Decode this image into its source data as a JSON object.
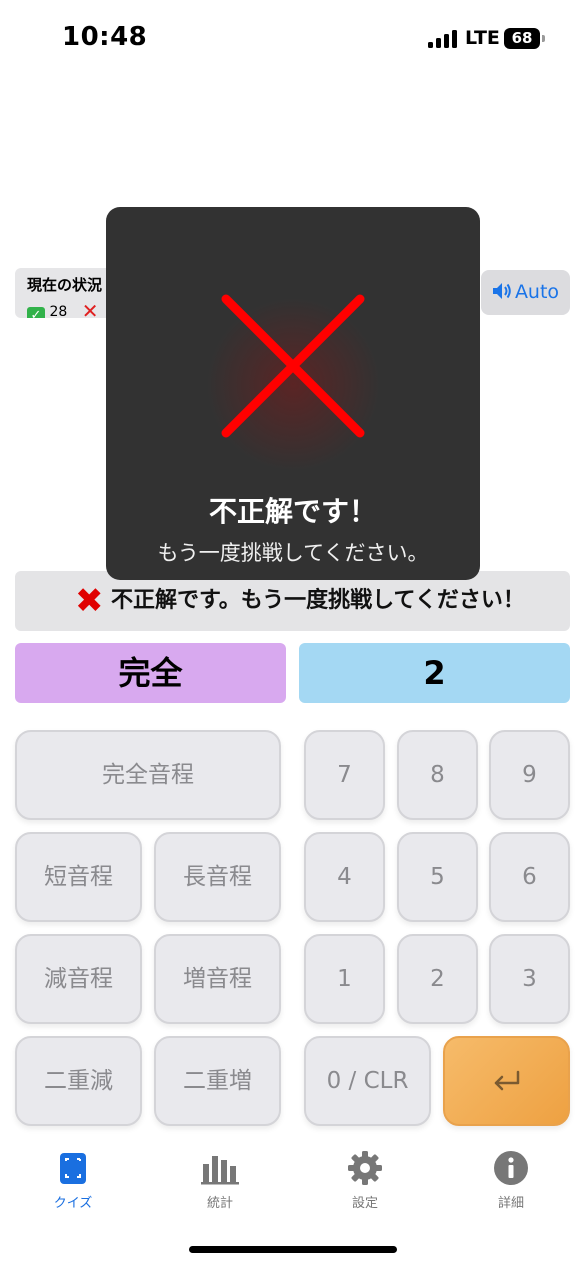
{
  "status_bar": {
    "time": "10:48",
    "network": "LTE",
    "battery": "68"
  },
  "status_box": {
    "title": "現在の状況",
    "correct_count": "28",
    "correct_icon": "check-icon",
    "wrong_icon": "cross-icon"
  },
  "audio": {
    "label": "Auto",
    "icon": "speaker-icon"
  },
  "feedback": {
    "icon": "cross-icon",
    "message": "不正解です。もう一度挑戦してください！"
  },
  "answer": {
    "quality": "完全",
    "number": "2"
  },
  "keypad": {
    "quality_keys": [
      "完全音程",
      "短音程",
      "長音程",
      "減音程",
      "増音程",
      "二重減",
      "二重増"
    ],
    "number_keys": [
      "7",
      "8",
      "9",
      "4",
      "5",
      "6",
      "1",
      "2",
      "3"
    ],
    "clear_label": "0 / CLR",
    "enter_icon": "return-icon"
  },
  "overlay": {
    "icon": "cross-icon",
    "title": "不正解です！",
    "message": "もう一度挑戦してください。"
  },
  "tab_bar": {
    "tabs": [
      {
        "label": "クイズ",
        "icon": "quiz-icon",
        "active": true
      },
      {
        "label": "統計",
        "icon": "chart-icon",
        "active": false
      },
      {
        "label": "設定",
        "icon": "gear-icon",
        "active": false
      },
      {
        "label": "詳細",
        "icon": "info-icon",
        "active": false
      }
    ]
  },
  "colors": {
    "accent": "#1a6fe0",
    "error": "#ff0000",
    "quality_bg": "#d8a9ef",
    "number_bg": "#a4d8f3",
    "enter_bg": "#f0a848"
  }
}
